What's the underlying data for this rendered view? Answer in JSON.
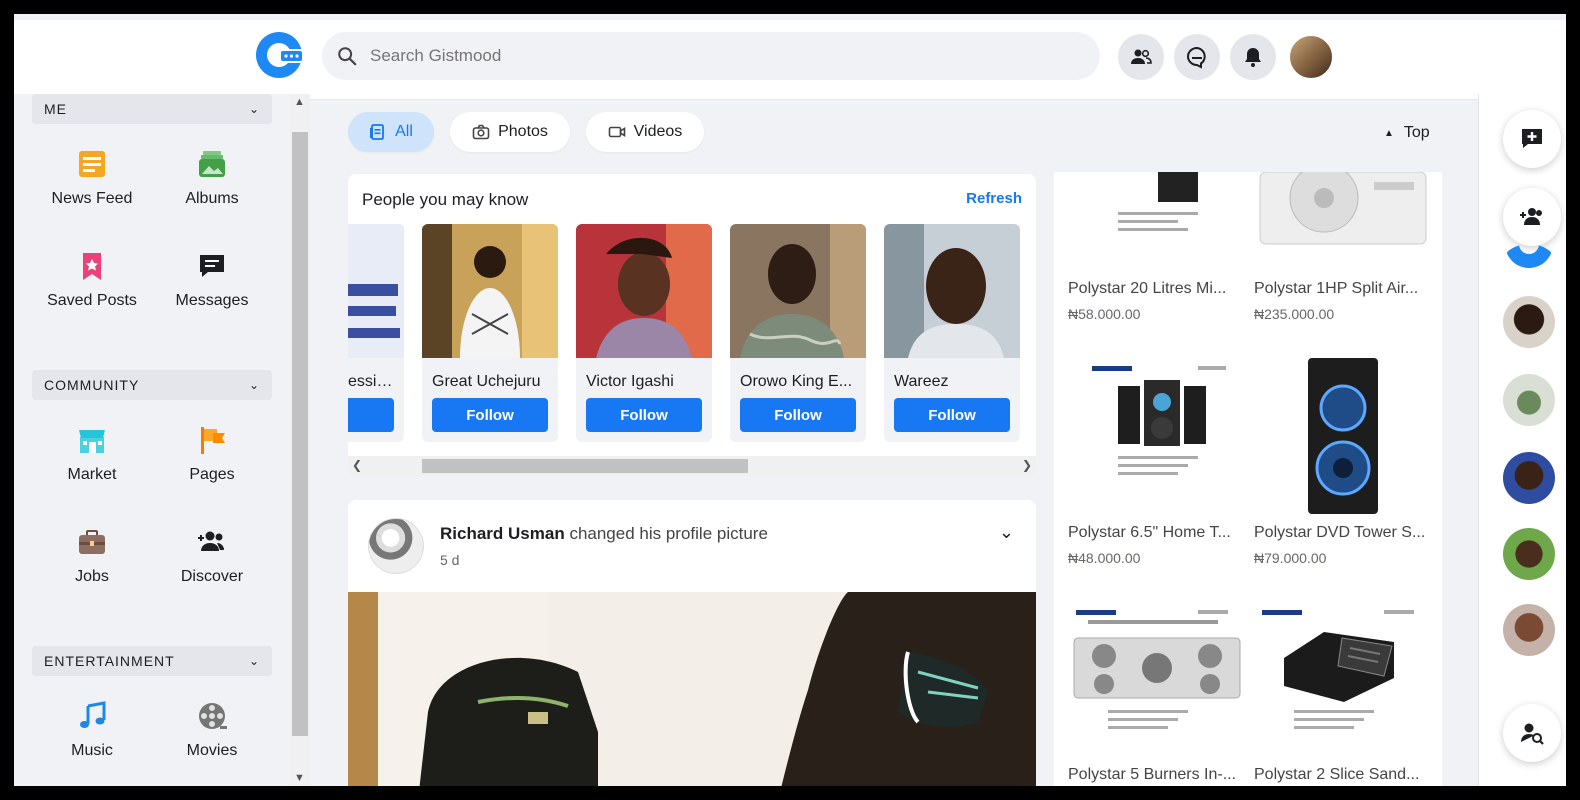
{
  "header": {
    "search_placeholder": "Search Gistmood"
  },
  "sidebar": {
    "sections": [
      {
        "title": "ME",
        "items": [
          "News Feed",
          "Albums",
          "Saved Posts",
          "Messages"
        ]
      },
      {
        "title": "COMMUNITY",
        "items": [
          "Market",
          "Pages",
          "Jobs",
          "Discover"
        ]
      },
      {
        "title": "ENTERTAINMENT",
        "items": [
          "Music",
          "Movies"
        ]
      }
    ]
  },
  "filters": {
    "all": "All",
    "photos": "Photos",
    "videos": "Videos",
    "top": "Top"
  },
  "pymk": {
    "title": "People you may know",
    "refresh": "Refresh",
    "people": [
      {
        "name": "essing",
        "follow": "w"
      },
      {
        "name": "Great Uchejuru",
        "follow": "Follow"
      },
      {
        "name": "Victor Igashi",
        "follow": "Follow"
      },
      {
        "name": "Orowo King E...",
        "follow": "Follow"
      },
      {
        "name": "Wareez",
        "follow": "Follow"
      }
    ]
  },
  "post": {
    "author": "Richard Usman",
    "action": "changed his profile picture",
    "time": "5 d"
  },
  "market": {
    "products": [
      {
        "title": "Polystar 20 Litres Mi...",
        "price": "₦58.000.00"
      },
      {
        "title": "Polystar 1HP Split Air...",
        "price": "₦235.000.00"
      },
      {
        "title": "Polystar 6.5\" Home T...",
        "price": "₦48.000.00"
      },
      {
        "title": "Polystar DVD Tower S...",
        "price": "₦79.000.00"
      },
      {
        "title": "Polystar 5 Burners In-...",
        "price": ""
      },
      {
        "title": "Polystar 2 Slice Sand...",
        "price": ""
      }
    ]
  },
  "colors": {
    "accent": "#1877f2",
    "background": "#f0f2f5"
  }
}
